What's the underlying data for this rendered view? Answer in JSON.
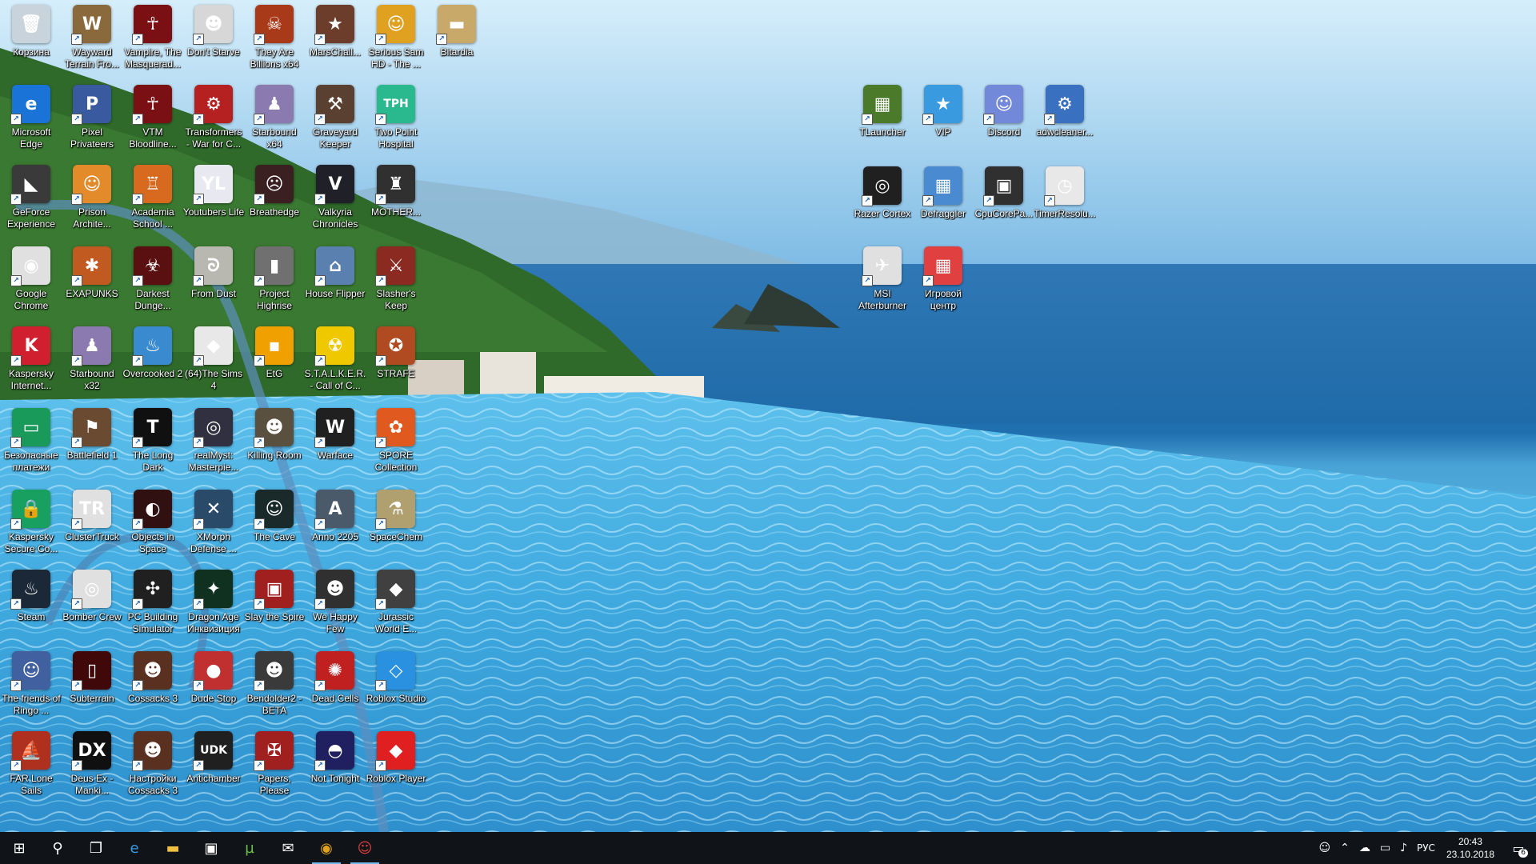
{
  "desktop_icons": [
    {
      "label": "Корзина",
      "color": "#c9d3dc",
      "glyph": "🗑",
      "shortcut": false
    },
    {
      "label": "Wayward Terrain Fro...",
      "color": "#8a6a3c",
      "glyph": "W"
    },
    {
      "label": "Vampire, The Masquerad...",
      "color": "#7a0f14",
      "glyph": "☥"
    },
    {
      "label": "Don't Starve",
      "color": "#d7d7d7",
      "glyph": "☻"
    },
    {
      "label": "They Are Billions x64",
      "color": "#a83a1a",
      "glyph": "☠"
    },
    {
      "label": "MarsChall...",
      "color": "#6b3d2a",
      "glyph": "★"
    },
    {
      "label": "Serious Sam HD - The ...",
      "color": "#e0a020",
      "glyph": "☺"
    },
    {
      "label": "Bitardia",
      "color": "#c8a96a",
      "glyph": "▬"
    },
    {
      "label": "Microsoft Edge",
      "color": "#1a73d6",
      "glyph": "e"
    },
    {
      "label": "Pixel Privateers",
      "color": "#3a5aa0",
      "glyph": "P"
    },
    {
      "label": "VTM Bloodline...",
      "color": "#7a0f14",
      "glyph": "☥"
    },
    {
      "label": "Transformers - War for C...",
      "color": "#b52020",
      "glyph": "⚙"
    },
    {
      "label": "Starbound x64",
      "color": "#8a7ab0",
      "glyph": "♟"
    },
    {
      "label": "Graveyard Keeper",
      "color": "#5a4030",
      "glyph": "⚒"
    },
    {
      "label": "Two Point Hospital",
      "color": "#2ab88e",
      "glyph": "TPH"
    },
    {
      "label": "GeForce Experience",
      "color": "#3a3a3a",
      "glyph": "◣"
    },
    {
      "label": "Prison Archite...",
      "color": "#e38a2a",
      "glyph": "☺"
    },
    {
      "label": "Academia School ...",
      "color": "#d86a20",
      "glyph": "♖"
    },
    {
      "label": "Youtubers Life",
      "color": "#e8e8f0",
      "glyph": "YL"
    },
    {
      "label": "Breathedge",
      "color": "#3a2020",
      "glyph": "☹"
    },
    {
      "label": "Valkyria Chronicles",
      "color": "#202028",
      "glyph": "V"
    },
    {
      "label": "MOTHER...",
      "color": "#303030",
      "glyph": "♜"
    },
    {
      "label": "Google Chrome",
      "color": "#e0e0e0",
      "glyph": "◉"
    },
    {
      "label": "EXAPUNKS",
      "color": "#c05a20",
      "glyph": "✱"
    },
    {
      "label": "Darkest Dunge...",
      "color": "#5a1010",
      "glyph": "☣"
    },
    {
      "label": "From Dust",
      "color": "#b8b8b0",
      "glyph": "ᘐ"
    },
    {
      "label": "Project Highrise",
      "color": "#707070",
      "glyph": "▮"
    },
    {
      "label": "House Flipper",
      "color": "#5a80b0",
      "glyph": "⌂"
    },
    {
      "label": "Slasher's Keep",
      "color": "#8a2a20",
      "glyph": "⚔"
    },
    {
      "label": "Kaspersky Internet...",
      "color": "#d02030",
      "glyph": "K"
    },
    {
      "label": "Starbound x32",
      "color": "#8a7ab0",
      "glyph": "♟"
    },
    {
      "label": "Overcooked 2",
      "color": "#3a8ad0",
      "glyph": "♨"
    },
    {
      "label": "(64)The Sims 4",
      "color": "#e8e8e8",
      "glyph": "◆"
    },
    {
      "label": "EtG",
      "color": "#f0a000",
      "glyph": "▪"
    },
    {
      "label": "S.T.A.L.K.E.R. - Call of C...",
      "color": "#f0c800",
      "glyph": "☢"
    },
    {
      "label": "STRAFE",
      "color": "#b04a20",
      "glyph": "✪"
    },
    {
      "label": "Безопасные платежи",
      "color": "#1a9a5a",
      "glyph": "▭"
    },
    {
      "label": "Battlefield 1",
      "color": "#6a4a30",
      "glyph": "⚑"
    },
    {
      "label": "The Long Dark",
      "color": "#101010",
      "glyph": "T"
    },
    {
      "label": "realMyst: Masterpie...",
      "color": "#303040",
      "glyph": "◎"
    },
    {
      "label": "Killing Room",
      "color": "#5a5040",
      "glyph": "☻"
    },
    {
      "label": "Warface",
      "color": "#202020",
      "glyph": "W"
    },
    {
      "label": "SPORE Collection",
      "color": "#e05a20",
      "glyph": "✿"
    },
    {
      "label": "Kaspersky Secure Co...",
      "color": "#18a060",
      "glyph": "🔒"
    },
    {
      "label": "ClusterTruck",
      "color": "#e0e0e0",
      "glyph": "TR"
    },
    {
      "label": "Objects in Space",
      "color": "#301010",
      "glyph": "◐"
    },
    {
      "label": "XMorph Defense ...",
      "color": "#2a4a6a",
      "glyph": "✕"
    },
    {
      "label": "The Cave",
      "color": "#1a2a2a",
      "glyph": "☺"
    },
    {
      "label": "Anno 2205",
      "color": "#4a5a6a",
      "glyph": "A"
    },
    {
      "label": "SpaceChem",
      "color": "#b0a070",
      "glyph": "⚗"
    },
    {
      "label": "Steam",
      "color": "#1b2838",
      "glyph": "♨"
    },
    {
      "label": "Bomber Crew",
      "color": "#e0e0e0",
      "glyph": "◎"
    },
    {
      "label": "PC Building Simulator",
      "color": "#202020",
      "glyph": "✣"
    },
    {
      "label": "Dragon Age Инквизиция",
      "color": "#103020",
      "glyph": "✦"
    },
    {
      "label": "Slay the Spire",
      "color": "#a02020",
      "glyph": "▣"
    },
    {
      "label": "We Happy Few",
      "color": "#303030",
      "glyph": "☻"
    },
    {
      "label": "Jurassic World E...",
      "color": "#404040",
      "glyph": "◆"
    },
    {
      "label": "The friends of Ringo ...",
      "color": "#4060a0",
      "glyph": "☺"
    },
    {
      "label": "Subterrain",
      "color": "#400808",
      "glyph": "▯"
    },
    {
      "label": "Cossacks 3",
      "color": "#5a3020",
      "glyph": "☻"
    },
    {
      "label": "Dude Stop",
      "color": "#c03030",
      "glyph": "●"
    },
    {
      "label": "Bendolder2 - BETA",
      "color": "#3a3a3a",
      "glyph": "☻"
    },
    {
      "label": "Dead Cells",
      "color": "#c02020",
      "glyph": "✺"
    },
    {
      "label": "Roblox Studio",
      "color": "#2a90e0",
      "glyph": "◇"
    },
    {
      "label": "FAR Lone Sails",
      "color": "#b03020",
      "glyph": "⛵"
    },
    {
      "label": "Deus Ex - Manki...",
      "color": "#101010",
      "glyph": "DX"
    },
    {
      "label": "Настройки Cossacks 3",
      "color": "#5a3020",
      "glyph": "☻"
    },
    {
      "label": "Antichamber",
      "color": "#202020",
      "glyph": "UDK"
    },
    {
      "label": "Papers, Please",
      "color": "#a02020",
      "glyph": "✠"
    },
    {
      "label": "Not Tonight",
      "color": "#202060",
      "glyph": "◓"
    },
    {
      "label": "Roblox Player",
      "color": "#e02020",
      "glyph": "◆"
    },
    {
      "label": "TLauncher",
      "color": "#4a7a2a",
      "glyph": "▦"
    },
    {
      "label": "VIP",
      "color": "#3a9ae0",
      "glyph": "★"
    },
    {
      "label": "Discord",
      "color": "#7289da",
      "glyph": "☺"
    },
    {
      "label": "adwcleaner...",
      "color": "#3a70c0",
      "glyph": "⚙"
    },
    {
      "label": "Razer Cortex",
      "color": "#202020",
      "glyph": "◎"
    },
    {
      "label": "Defraggler",
      "color": "#4a8ad0",
      "glyph": "▦"
    },
    {
      "label": "CpuCorePa...",
      "color": "#303030",
      "glyph": "▣"
    },
    {
      "label": "TimerResolu...",
      "color": "#e8e8e8",
      "glyph": "◷"
    },
    {
      "label": "MSI Afterburner",
      "color": "#e0e0e0",
      "glyph": "✈"
    },
    {
      "label": "Игровой центр",
      "color": "#e04040",
      "glyph": "▦"
    }
  ],
  "taskbar": {
    "start_glyph": "⊞",
    "search_glyph": "⚲",
    "taskview_glyph": "❐",
    "pinned": [
      {
        "name": "edge",
        "glyph": "e",
        "color": "#3a9ae0"
      },
      {
        "name": "explorer",
        "glyph": "▬",
        "color": "#f0c040"
      },
      {
        "name": "store",
        "glyph": "▣",
        "color": "#ffffff"
      },
      {
        "name": "utorrent",
        "glyph": "µ",
        "color": "#6cc04a"
      },
      {
        "name": "mail",
        "glyph": "✉",
        "color": "#ffffff"
      },
      {
        "name": "chrome",
        "glyph": "◉",
        "color": "#e0a020"
      },
      {
        "name": "discord",
        "glyph": "☺",
        "color": "#e04040"
      }
    ],
    "tray": {
      "people_glyph": "☺",
      "chevron_glyph": "⌃",
      "onedrive_glyph": "☁",
      "network_glyph": "▭",
      "volume_glyph": "♪",
      "language": "РУС",
      "time": "20:43",
      "date": "23.10.2018",
      "notification_glyph": "▭",
      "notification_count": "6"
    }
  }
}
